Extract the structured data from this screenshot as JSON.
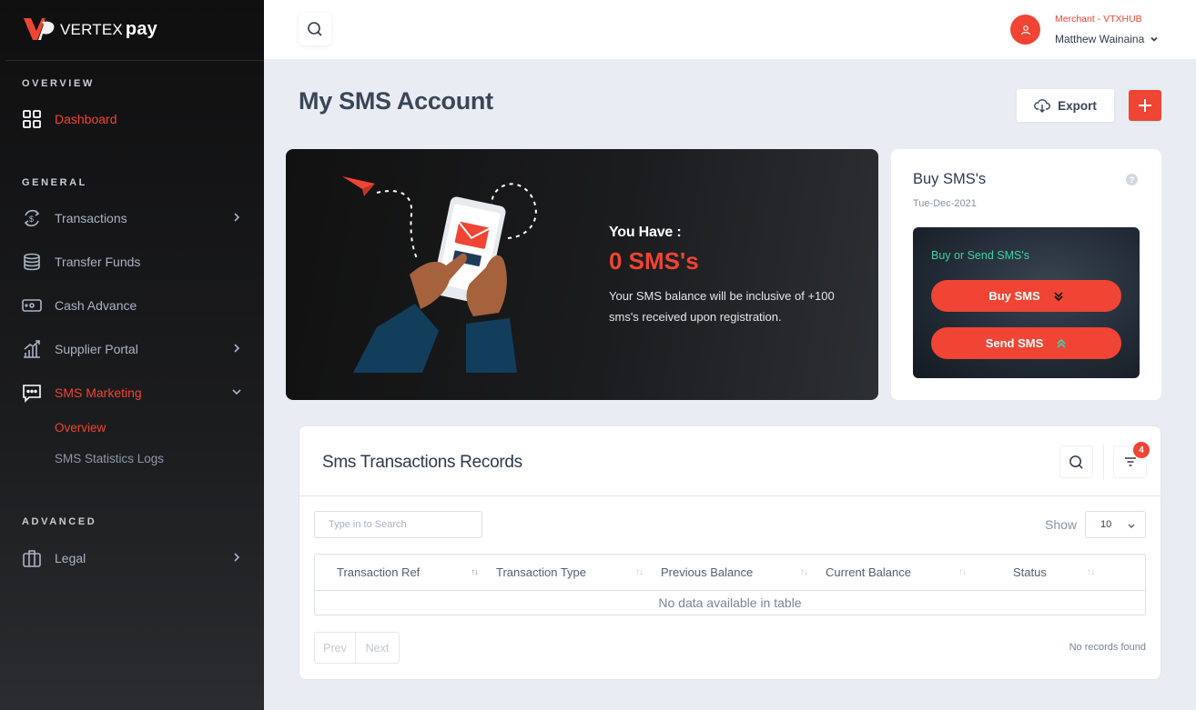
{
  "brand": {
    "name": "VERTEX",
    "suffix": "pay"
  },
  "sidebar": {
    "sections": {
      "overview": "OVERVIEW",
      "general": "GENERAL",
      "advanced": "ADVANCED"
    },
    "items": {
      "dashboard": "Dashboard",
      "transactions": "Transactions",
      "transfer_funds": "Transfer Funds",
      "cash_advance": "Cash Advance",
      "supplier_portal": "Supplier Portal",
      "sms_marketing": "SMS Marketing",
      "legal": "Legal"
    },
    "sms_sub": {
      "overview": "Overview",
      "statistics": "SMS Statistics Logs"
    }
  },
  "header": {
    "merchant": "Merchant - VTXHUB",
    "user": "Matthew Wainaina"
  },
  "page": {
    "title": "My SMS Account",
    "export_label": "Export",
    "add_label": "+"
  },
  "hero": {
    "you_have": "You Have :",
    "count": "0 SMS's",
    "note": "Your SMS balance will be inclusive of +100 sms's received upon registration."
  },
  "buy_card": {
    "title": "Buy SMS's",
    "help": "?",
    "date": "Tue-Dec-2021",
    "panel_label": "Buy or Send SMS's",
    "buy_label": "Buy SMS",
    "send_label": "Send SMS"
  },
  "records": {
    "title": "Sms Transactions Records",
    "filter_count": "4",
    "search_placeholder": "Type in to Search",
    "show_label": "Show",
    "page_size": "10",
    "columns": [
      "Transaction Ref",
      "Transaction Type",
      "Previous Balance",
      "Current Balance",
      "Status"
    ],
    "sort_glyph": "↑↓",
    "empty_message": "No data available in table",
    "prev_label": "Prev",
    "next_label": "Next",
    "footer_info": "No records found"
  },
  "colors": {
    "accent": "#f04434",
    "sidebar_bg": "#141416",
    "page_bg": "#e9edf3",
    "success_text": "#3ed3a1"
  }
}
